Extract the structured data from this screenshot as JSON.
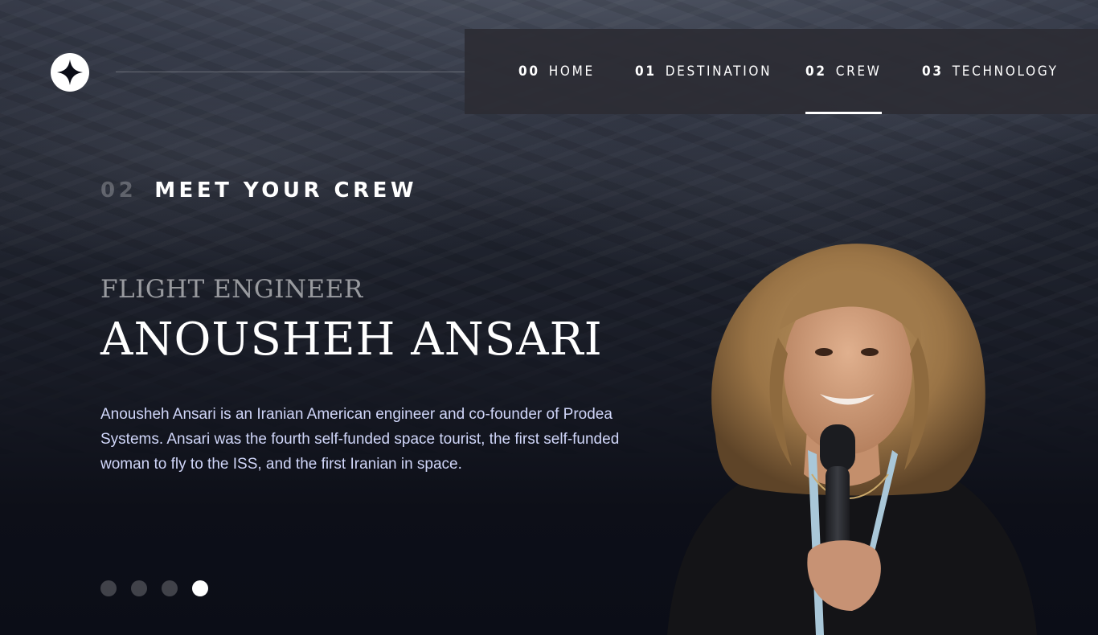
{
  "nav": {
    "items": [
      {
        "num": "00",
        "label": "HOME"
      },
      {
        "num": "01",
        "label": "DESTINATION"
      },
      {
        "num": "02",
        "label": "CREW"
      },
      {
        "num": "03",
        "label": "TECHNOLOGY"
      }
    ],
    "active_index": 2
  },
  "heading": {
    "num": "02",
    "title": "MEET YOUR CREW"
  },
  "crew": {
    "role": "FLIGHT ENGINEER",
    "name": "ANOUSHEH ANSARI",
    "bio": "Anousheh Ansari is an Iranian American engineer and co-founder of Prodea Systems. Ansari was the fourth self-funded space tourist, the first self-funded woman to fly to the ISS, and the first Iranian in space."
  },
  "slider": {
    "count": 4,
    "active_index": 3
  },
  "icons": {
    "logo": "star-logo-icon"
  },
  "colors": {
    "background": "#0b0d17",
    "nav_background": "#2c2d34",
    "bio_text": "#d0d6f9",
    "accent": "#ffffff"
  }
}
